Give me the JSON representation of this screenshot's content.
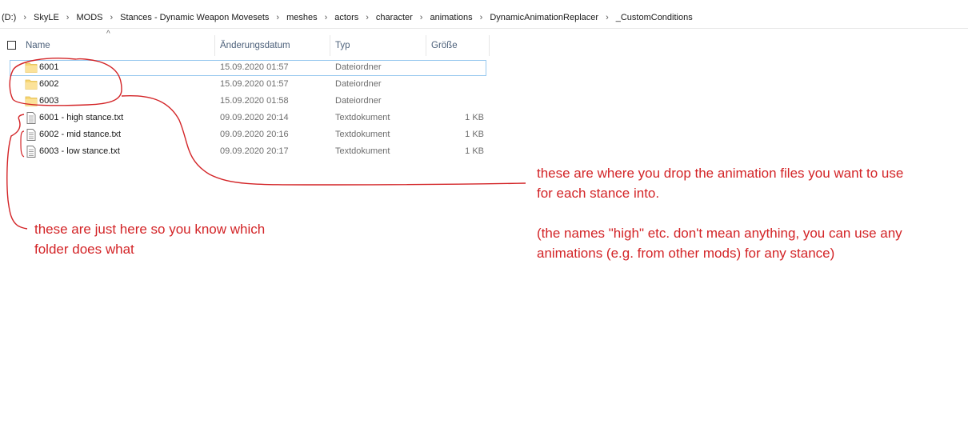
{
  "breadcrumb": {
    "items": [
      "(D:)",
      "SkyLE",
      "MODS",
      "Stances - Dynamic Weapon Movesets",
      "meshes",
      "actors",
      "character",
      "animations",
      "DynamicAnimationReplacer",
      "_CustomConditions"
    ],
    "separator": "›"
  },
  "columns": {
    "name": "Name",
    "date": "Änderungsdatum",
    "type": "Typ",
    "size": "Größe"
  },
  "files": [
    {
      "name": "6001",
      "date": "15.09.2020 01:57",
      "type": "Dateiordner",
      "size": "",
      "icon": "folder-icon"
    },
    {
      "name": "6002",
      "date": "15.09.2020 01:57",
      "type": "Dateiordner",
      "size": "",
      "icon": "folder-icon"
    },
    {
      "name": "6003",
      "date": "15.09.2020 01:58",
      "type": "Dateiordner",
      "size": "",
      "icon": "folder-icon"
    },
    {
      "name": "6001 - high stance.txt",
      "date": "09.09.2020 20:14",
      "type": "Textdokument",
      "size": "1 KB",
      "icon": "text-document-icon"
    },
    {
      "name": "6002 - mid stance.txt",
      "date": "09.09.2020 20:16",
      "type": "Textdokument",
      "size": "1 KB",
      "icon": "text-document-icon"
    },
    {
      "name": "6003 - low stance.txt",
      "date": "09.09.2020 20:17",
      "type": "Textdokument",
      "size": "1 KB",
      "icon": "text-document-icon"
    }
  ],
  "annotations": {
    "left_note_line1": "these are just here so you know which",
    "left_note_line2": "folder does what",
    "right_note_line1": "these are where you drop the animation files you want to use",
    "right_note_line2": "for each stance into.",
    "right_note_line3": "(the names \"high\" etc. don't mean anything, you can use any",
    "right_note_line4": "animations (e.g. from other mods) for any stance)"
  },
  "colors": {
    "annotation": "#d32427",
    "folder": "#f8d775",
    "header_text": "#4c607a",
    "selection_border": "#99c9ef"
  }
}
